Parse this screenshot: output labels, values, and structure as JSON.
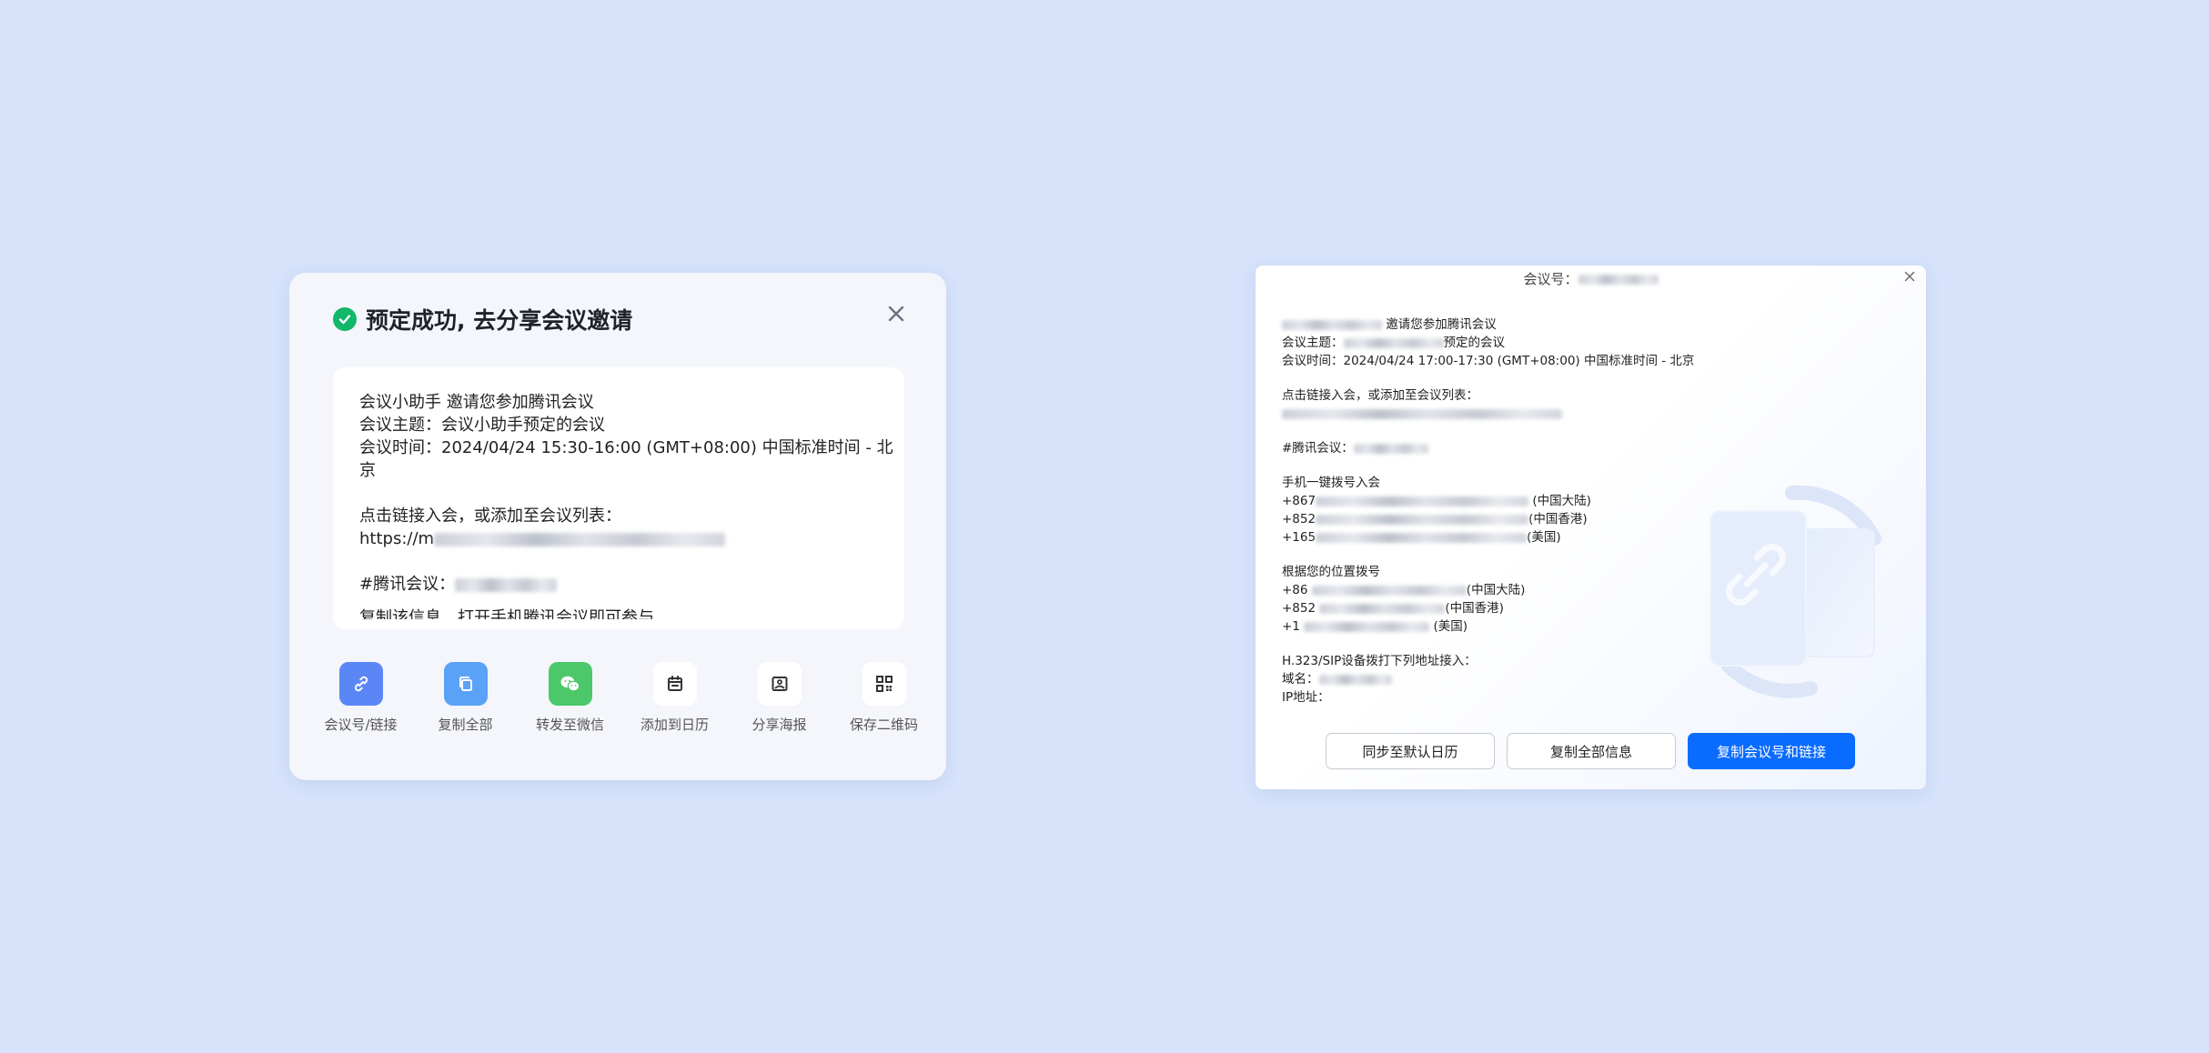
{
  "left_dialog": {
    "title": "预定成功, 去分享会议邀请",
    "invite": {
      "line1": "会议小助手 邀请您参加腾讯会议",
      "line2": "会议主题：会议小助手预定的会议",
      "line3": "会议时间：2024/04/24 15:30-16:00 (GMT+08:00) 中国标准时间 - 北京",
      "line4": "点击链接入会，或添加至会议列表：",
      "link_prefix": "https://m",
      "meeting_prefix": "#腾讯会议：",
      "truncated": "复制该信息，打开手机腾讯会议即可参与"
    },
    "actions": [
      {
        "label": "会议号/链接",
        "icon": "link-icon",
        "color": "#5b86f5"
      },
      {
        "label": "复制全部",
        "icon": "copy-icon",
        "color": "#5aa2f7"
      },
      {
        "label": "转发至微信",
        "icon": "wechat-icon",
        "color": "#4cc86a"
      },
      {
        "label": "添加到日历",
        "icon": "calendar-icon",
        "color": "#ffffff"
      },
      {
        "label": "分享海报",
        "icon": "image-icon",
        "color": "#ffffff"
      },
      {
        "label": "保存二维码",
        "icon": "qrcode-icon",
        "color": "#ffffff"
      }
    ]
  },
  "right_dialog": {
    "header_label": "会议号：",
    "body": {
      "invite_suffix": "邀请您参加腾讯会议",
      "topic_prefix": "会议主题：",
      "topic_suffix": "预定的会议",
      "time": "会议时间：2024/04/24 17:00-17:30 (GMT+08:00) 中国标准时间 - 北京",
      "link_hint": "点击链接入会，或添加至会议列表：",
      "meeting_prefix": "#腾讯会议：",
      "one_tap_title": "手机一键拨号入会",
      "one_tap": [
        {
          "prefix": "+867",
          "region": "(中国大陆)"
        },
        {
          "prefix": "+852",
          "region": "(中国香港)"
        },
        {
          "prefix": "+165",
          "region": "(美国)"
        }
      ],
      "location_title": "根据您的位置拨号",
      "location": [
        {
          "prefix": "+86",
          "region": "(中国大陆)"
        },
        {
          "prefix": "+852",
          "region": "(中国香港)"
        },
        {
          "prefix": "+1",
          "region": "(美国)"
        }
      ],
      "sip_title": "H.323/SIP设备拨打下列地址接入：",
      "domain_label": "域名：",
      "ip_label": "IP地址："
    },
    "buttons": {
      "sync": "同步至默认日历",
      "copy_all": "复制全部信息",
      "copy_link": "复制会议号和链接"
    },
    "primary_color": "#0a6cff"
  }
}
